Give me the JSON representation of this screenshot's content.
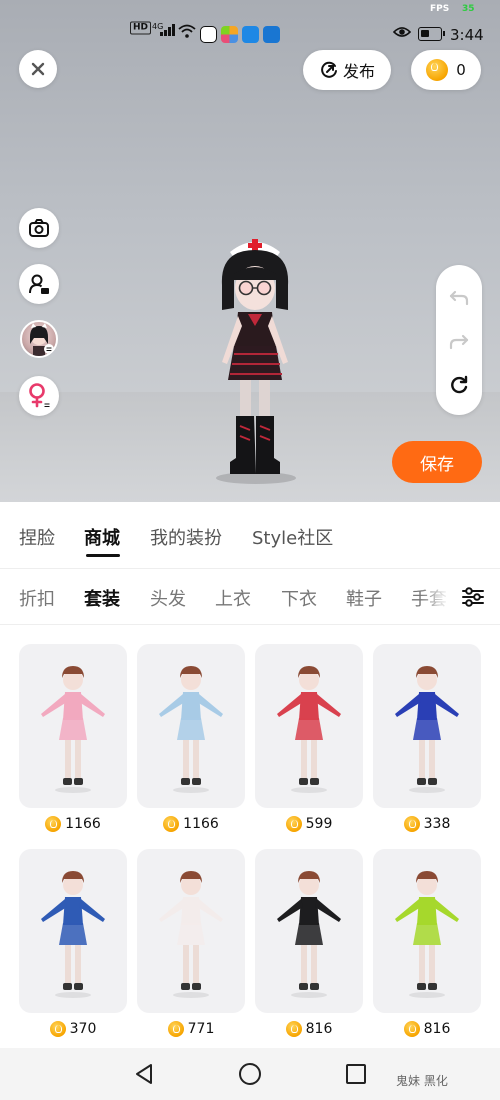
{
  "status_bar": {
    "network": "4G",
    "hd": "HD",
    "fps_label": "FPS",
    "fps_value": "35",
    "time": "3:44"
  },
  "top_actions": {
    "close_icon": "close-icon",
    "publish_label": "发布",
    "coin_balance": "0"
  },
  "side_tools": {
    "icons": [
      "camera-icon",
      "user-id-icon",
      "avatar-switch-icon",
      "gender-switch-icon"
    ]
  },
  "history": {
    "icons": [
      "undo-icon",
      "redo-icon",
      "reset-icon"
    ]
  },
  "save_label": "保存",
  "main_tabs": [
    {
      "label": "捏脸"
    },
    {
      "label": "商城"
    },
    {
      "label": "我的装扮"
    },
    {
      "label": "Style社区"
    }
  ],
  "main_tab_active": "商城",
  "sub_tabs": [
    {
      "label": "折扣"
    },
    {
      "label": "套装"
    },
    {
      "label": "头发"
    },
    {
      "label": "上衣"
    },
    {
      "label": "下衣"
    },
    {
      "label": "鞋子"
    },
    {
      "label": "手套"
    }
  ],
  "sub_tab_active": "套装",
  "items": [
    {
      "price": "1166",
      "outfit": "pink-plaid-skirt",
      "color": "#f2a9bf"
    },
    {
      "price": "1166",
      "outfit": "blue-plaid-skirt",
      "color": "#a8cbe6"
    },
    {
      "price": "599",
      "outfit": "red-school-uniform",
      "color": "#d9414e"
    },
    {
      "price": "338",
      "outfit": "blue-robe",
      "color": "#2a3fb5"
    },
    {
      "price": "370",
      "outfit": "white-blue-hoodie",
      "color": "#2f5bb5"
    },
    {
      "price": "771",
      "outfit": "white-sailor-dress",
      "color": "#f3eceb"
    },
    {
      "price": "816",
      "outfit": "black-gothic-dress",
      "color": "#1d1d1f"
    },
    {
      "price": "816",
      "outfit": "green-gothic-dress",
      "color": "#a6d82c"
    }
  ],
  "nav": {
    "icons": [
      "back-icon",
      "home-icon",
      "recents-icon"
    ]
  },
  "watermark": "鬼妹 黑化",
  "colors": {
    "accent": "#ff6a13",
    "coin": "#f7a500"
  }
}
